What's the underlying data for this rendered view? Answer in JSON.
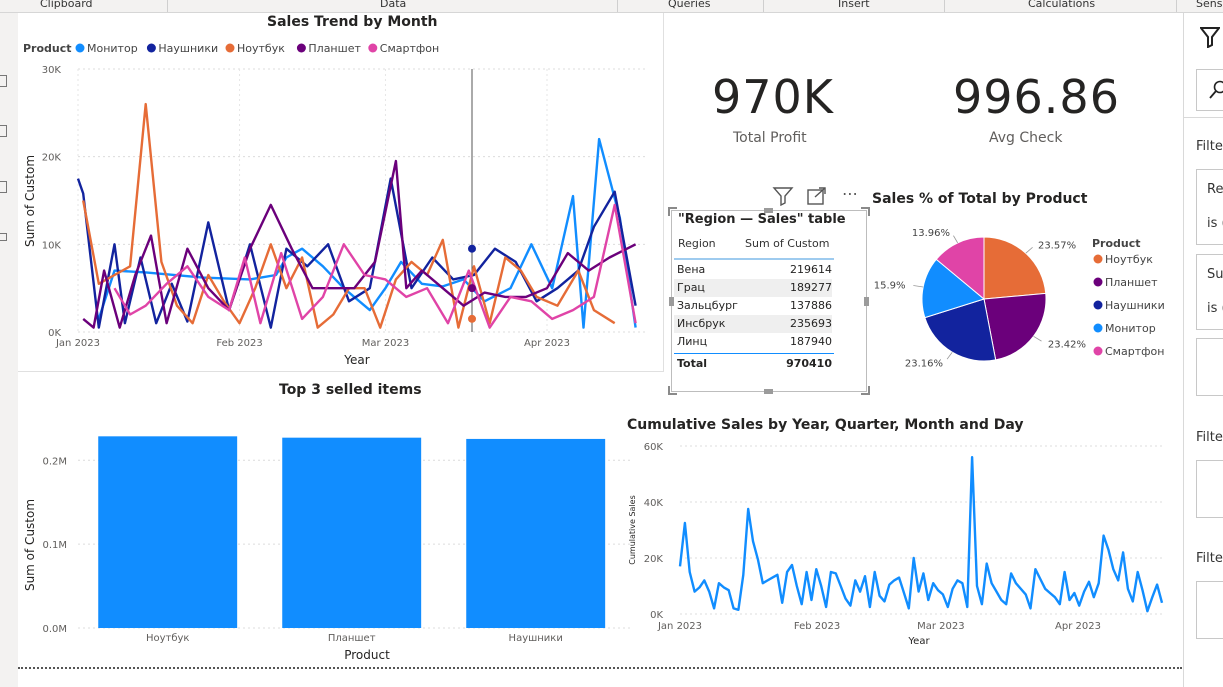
{
  "ribbon": {
    "groups": [
      "Clipboard",
      "Data",
      "Queries",
      "Insert",
      "Calculations",
      "Sens"
    ]
  },
  "right_pane": {
    "filter_label": "Filte",
    "filter_label_2": "Filte",
    "filter_label_3": "Filte",
    "card1_line1": "Re",
    "card1_line2": "is (",
    "card2_line1": "Su",
    "card2_line2": "is ("
  },
  "cards": {
    "profit": {
      "value": "970K",
      "label": "Total Profit"
    },
    "avg": {
      "value": "996.86",
      "label": "Avg Check"
    }
  },
  "colors": {
    "monitor": "#118DFF",
    "headphones": "#12239E",
    "laptop": "#E66C37",
    "tablet": "#6B007B",
    "smartphone": "#E044A7",
    "bar": "#118DFF"
  },
  "line_chart": {
    "title": "Sales Trend by Month",
    "legend_title": "Product",
    "xlabel": "Year",
    "ylabel": "Sum of Custom",
    "y_ticks": [
      "0K",
      "10K",
      "20K",
      "30K"
    ],
    "x_ticks": [
      "Jan 2023",
      "Feb 2023",
      "Mar 2023",
      "Apr 2023"
    ]
  },
  "table": {
    "title": "\"Region — Sales\" table",
    "col1": "Region",
    "col2": "Sum of Custom",
    "rows": [
      {
        "region": "Вена",
        "value": "219614"
      },
      {
        "region": "Грац",
        "value": "189277"
      },
      {
        "region": "Зальцбург",
        "value": "137886"
      },
      {
        "region": "Инсбрук",
        "value": "235693"
      },
      {
        "region": "Линц",
        "value": "187940"
      }
    ],
    "total_label": "Total",
    "total_value": "970410"
  },
  "pie": {
    "title": "Sales % of Total by Product",
    "legend_title": "Product",
    "slice_labels": [
      "23.57%",
      "23.42%",
      "23.16%",
      "15.9%",
      "13.96%"
    ]
  },
  "bar": {
    "title": "Top 3 selled items",
    "xlabel": "Product",
    "ylabel": "Sum of Custom",
    "y_ticks": [
      "0.0M",
      "0.1M",
      "0.2M"
    ]
  },
  "cumulative": {
    "title": "Cumulative Sales by Year, Quarter, Month and Day",
    "xlabel": "Year",
    "ylabel": "Cumulative Sales",
    "y_ticks": [
      "0K",
      "20K",
      "40K",
      "60K"
    ],
    "x_ticks": [
      "Jan 2023",
      "Feb 2023",
      "Mar 2023",
      "Apr 2023"
    ]
  },
  "chart_data": [
    {
      "type": "line",
      "title": "Sales Trend by Month",
      "xlabel": "Year",
      "ylabel": "Sum of Custom",
      "ylim": [
        0,
        30000
      ],
      "x_range": [
        "2023-01-01",
        "2023-04-20"
      ],
      "series": [
        {
          "name": "Монитор",
          "color": "#118DFF",
          "x": [
            "2023-01-05",
            "2023-01-08",
            "2023-01-14",
            "2023-01-25",
            "2023-02-03",
            "2023-02-08",
            "2023-02-10",
            "2023-02-13",
            "2023-02-17",
            "2023-02-21",
            "2023-02-26",
            "2023-03-01",
            "2023-03-04",
            "2023-03-08",
            "2023-03-12",
            "2023-03-16",
            "2023-03-20",
            "2023-03-25",
            "2023-03-29",
            "2023-04-02",
            "2023-04-06",
            "2023-04-08",
            "2023-04-11",
            "2023-04-15",
            "2023-04-18"
          ],
          "values": [
            1500,
            7000,
            6800,
            6200,
            6000,
            6500,
            8500,
            9500,
            7500,
            5000,
            2500,
            5000,
            8000,
            5500,
            5200,
            6000,
            3500,
            5000,
            10000,
            5000,
            15500,
            500,
            22000,
            13000,
            500
          ]
        },
        {
          "name": "Наушники",
          "color": "#12239E",
          "x": [
            "2023-01-01",
            "2023-01-02",
            "2023-01-05",
            "2023-01-08",
            "2023-01-10",
            "2023-01-13",
            "2023-01-16",
            "2023-01-19",
            "2023-01-22",
            "2023-01-26",
            "2023-01-30",
            "2023-02-03",
            "2023-02-07",
            "2023-02-10",
            "2023-02-14",
            "2023-02-18",
            "2023-02-22",
            "2023-02-26",
            "2023-03-02",
            "2023-03-06",
            "2023-03-10",
            "2023-03-14",
            "2023-03-18",
            "2023-03-22",
            "2023-03-26",
            "2023-03-30",
            "2023-04-03",
            "2023-04-07",
            "2023-04-10",
            "2023-04-14",
            "2023-04-18"
          ],
          "values": [
            17500,
            15800,
            500,
            10000,
            1000,
            8500,
            1000,
            5500,
            1200,
            12500,
            2500,
            10000,
            500,
            9500,
            7500,
            10000,
            3500,
            5000,
            17500,
            5000,
            8500,
            6000,
            6500,
            9500,
            8000,
            3500,
            5000,
            7000,
            12000,
            16000,
            3000
          ]
        },
        {
          "name": "Ноутбук",
          "color": "#E66C37",
          "x": [
            "2023-01-02",
            "2023-01-05",
            "2023-01-08",
            "2023-01-11",
            "2023-01-14",
            "2023-01-17",
            "2023-01-20",
            "2023-01-23",
            "2023-01-26",
            "2023-01-29",
            "2023-02-01",
            "2023-02-04",
            "2023-02-07",
            "2023-02-10",
            "2023-02-13",
            "2023-02-16",
            "2023-02-19",
            "2023-02-22",
            "2023-02-25",
            "2023-02-28",
            "2023-03-03",
            "2023-03-06",
            "2023-03-09",
            "2023-03-12",
            "2023-03-15",
            "2023-03-18",
            "2023-03-21",
            "2023-03-24",
            "2023-03-27",
            "2023-03-30",
            "2023-04-03",
            "2023-04-07",
            "2023-04-10",
            "2023-04-14"
          ],
          "values": [
            15000,
            5500,
            6500,
            7500,
            26000,
            8000,
            3000,
            1000,
            6500,
            3500,
            1000,
            5000,
            10000,
            5000,
            8500,
            500,
            2000,
            5000,
            5000,
            500,
            6000,
            8000,
            6500,
            10500,
            500,
            7500,
            1000,
            8500,
            7000,
            4000,
            3000,
            7000,
            2500,
            1000
          ]
        },
        {
          "name": "Планшет",
          "color": "#6B007B",
          "x": [
            "2023-01-02",
            "2023-01-04",
            "2023-01-06",
            "2023-01-09",
            "2023-01-12",
            "2023-01-15",
            "2023-01-18",
            "2023-01-22",
            "2023-01-26",
            "2023-01-30",
            "2023-02-03",
            "2023-02-07",
            "2023-02-11",
            "2023-02-15",
            "2023-02-19",
            "2023-02-23",
            "2023-02-27",
            "2023-03-03",
            "2023-03-05",
            "2023-03-08",
            "2023-03-12",
            "2023-03-16",
            "2023-03-20",
            "2023-03-24",
            "2023-03-28",
            "2023-04-01",
            "2023-04-05",
            "2023-04-09",
            "2023-04-13",
            "2023-04-18"
          ],
          "values": [
            1500,
            500,
            7000,
            500,
            6500,
            11000,
            1000,
            9500,
            5000,
            2500,
            9500,
            14500,
            9500,
            5000,
            5000,
            5000,
            8000,
            19500,
            5000,
            7000,
            5000,
            3000,
            4500,
            4000,
            4000,
            5000,
            9000,
            7000,
            8500,
            10000
          ]
        },
        {
          "name": "Смартфон",
          "color": "#E044A7",
          "x": [
            "2023-01-08",
            "2023-01-11",
            "2023-01-14",
            "2023-01-18",
            "2023-01-22",
            "2023-01-26",
            "2023-01-30",
            "2023-02-02",
            "2023-02-05",
            "2023-02-09",
            "2023-02-13",
            "2023-02-17",
            "2023-02-21",
            "2023-02-25",
            "2023-03-01",
            "2023-03-05",
            "2023-03-09",
            "2023-03-13",
            "2023-03-17",
            "2023-03-21",
            "2023-03-25",
            "2023-03-29",
            "2023-04-02",
            "2023-04-06",
            "2023-04-10",
            "2023-04-14",
            "2023-04-18"
          ],
          "values": [
            5000,
            2000,
            3000,
            5500,
            7500,
            4000,
            2500,
            8500,
            1000,
            9000,
            1500,
            4000,
            10000,
            6500,
            6000,
            4000,
            5000,
            1000,
            7000,
            500,
            4000,
            3500,
            1500,
            2500,
            4000,
            14500,
            1000
          ]
        }
      ]
    },
    {
      "type": "table",
      "title": "\"Region — Sales\" table",
      "columns": [
        "Region",
        "Sum of Custom"
      ],
      "rows": [
        [
          "Вена",
          219614
        ],
        [
          "Грац",
          189277
        ],
        [
          "Зальцбург",
          137886
        ],
        [
          "Инсбрук",
          235693
        ],
        [
          "Линц",
          187940
        ]
      ],
      "total": 970410
    },
    {
      "type": "pie",
      "title": "Sales % of Total by Product",
      "labels": [
        "Ноутбук",
        "Планшет",
        "Наушники",
        "Монитор",
        "Смартфон"
      ],
      "values": [
        23.57,
        23.42,
        23.16,
        15.9,
        13.96
      ],
      "colors": [
        "#E66C37",
        "#6B007B",
        "#12239E",
        "#118DFF",
        "#E044A7"
      ],
      "legend": "right"
    },
    {
      "type": "bar",
      "title": "Top 3 selled items",
      "xlabel": "Product",
      "ylabel": "Sum of Custom",
      "categories": [
        "Ноутбук",
        "Планшет",
        "Наушники"
      ],
      "values": [
        228600,
        227000,
        225500
      ],
      "ylim": [
        0,
        260000
      ]
    },
    {
      "type": "line",
      "title": "Cumulative Sales by Year, Quarter, Month and Day",
      "xlabel": "Year",
      "ylabel": "Cumulative Sales",
      "ylim": [
        0,
        60000
      ],
      "x_range": [
        "2023-01-01",
        "2023-04-20"
      ],
      "series": [
        {
          "name": "Cumulative Sales",
          "color": "#118DFF",
          "values": [
            17000,
            32500,
            15000,
            8000,
            9500,
            12000,
            8000,
            2000,
            11000,
            9500,
            8500,
            2000,
            1500,
            14000,
            37500,
            26000,
            19500,
            11000,
            12000,
            13000,
            14000,
            4000,
            15000,
            17500,
            10000,
            3500,
            15000,
            5000,
            16000,
            10000,
            2500,
            15000,
            14500,
            10000,
            5500,
            3000,
            12000,
            8000,
            13500,
            2500,
            15000,
            6500,
            4500,
            10500,
            12000,
            13000,
            7500,
            2000,
            20000,
            8000,
            14500,
            5000,
            11000,
            8500,
            7000,
            2500,
            9000,
            12000,
            11000,
            2500,
            56000,
            10000,
            3500,
            18000,
            11000,
            8000,
            5000,
            3500,
            14500,
            11000,
            9000,
            7000,
            2000,
            16000,
            12500,
            9000,
            7500,
            6000,
            3500,
            15000,
            5000,
            7500,
            3000,
            8000,
            11500,
            6000,
            11000,
            28000,
            23000,
            16000,
            12000,
            22000,
            9000,
            4500,
            15000,
            8500,
            1000,
            6000,
            10500,
            4000
          ]
        }
      ]
    }
  ]
}
